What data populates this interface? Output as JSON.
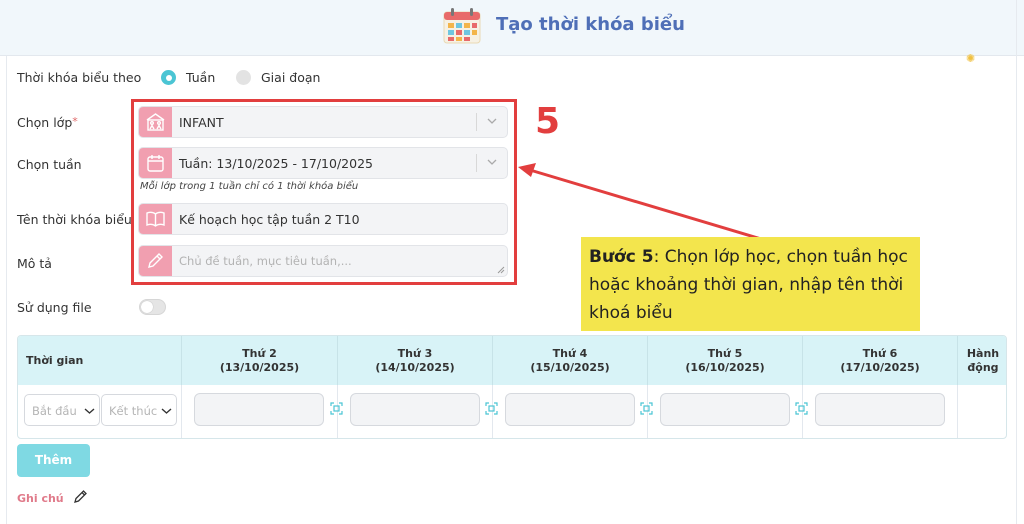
{
  "header": {
    "title": "Tạo thời khóa biểu",
    "icon": "calendar-grid-icon"
  },
  "form": {
    "schedule_by_label": "Thời khóa biểu theo",
    "radio_week": "Tuần",
    "radio_period": "Giai đoạn",
    "selected_mode": "Tuần",
    "class_label": "Chọn lớp",
    "required_mark": "*",
    "class_value": "INFANT",
    "week_label": "Chọn tuần",
    "week_value": "Tuần: 13/10/2025 - 17/10/2025",
    "week_hint": "Mỗi lớp trong 1 tuần chỉ có 1 thời khóa biểu",
    "name_label": "Tên thời khóa biểu",
    "name_value": "Kế hoạch học tập tuần 2 T10",
    "desc_label": "Mô tả",
    "desc_placeholder": "Chủ đề tuần, mục tiêu tuần,...",
    "file_label": "Sử dụng file",
    "use_file": false
  },
  "annotation": {
    "step_number": "5",
    "callout_bold": "Bước 5",
    "callout_text": ": Chọn lớp học, chọn tuần học hoặc khoảng thời gian, nhập tên thời khoá biểu",
    "highlight_color": "#e23e3e",
    "callout_color": "#f3e54d"
  },
  "table": {
    "time_header": "Thời gian",
    "action_header_1": "Hành",
    "action_header_2": "động",
    "days": [
      {
        "name": "Thứ 2",
        "date": "(13/10/2025)"
      },
      {
        "name": "Thứ 3",
        "date": "(14/10/2025)"
      },
      {
        "name": "Thứ 4",
        "date": "(15/10/2025)"
      },
      {
        "name": "Thứ 5",
        "date": "(16/10/2025)"
      },
      {
        "name": "Thứ 6",
        "date": "(17/10/2025)"
      }
    ],
    "start_placeholder": "Bắt đầu",
    "end_placeholder": "Kết thúc"
  },
  "actions": {
    "add_label": "Thêm"
  },
  "footer": {
    "note_label": "Ghi chú"
  },
  "colors": {
    "accent": "#4bc5d4",
    "pink": "#f19fb0",
    "header_bg": "#d8f3f7",
    "title": "#4f6fb7"
  }
}
